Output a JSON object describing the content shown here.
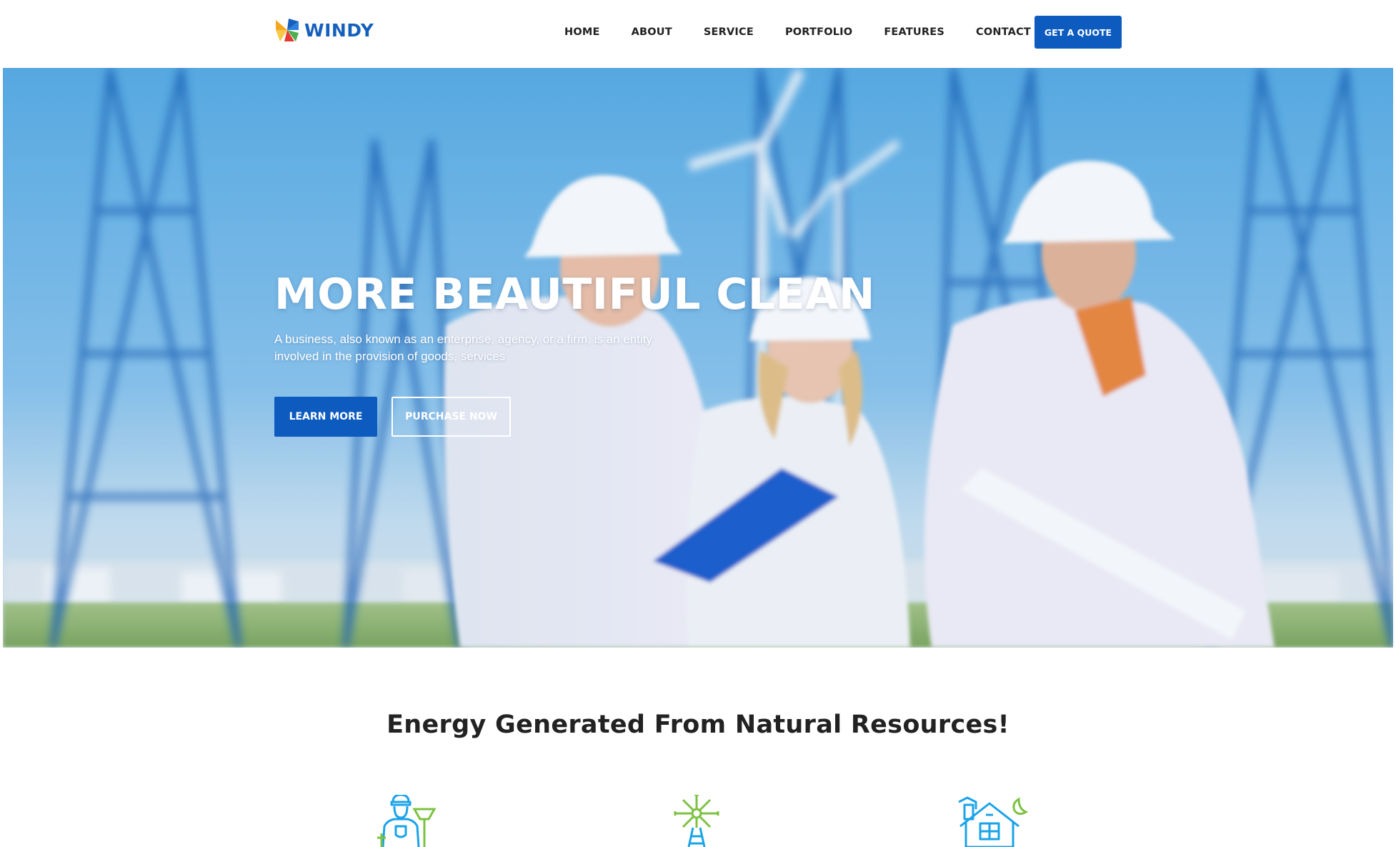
{
  "brand": {
    "name": "WINDY",
    "logo_colors": [
      "#f5a623",
      "#1560bd",
      "#4caf50",
      "#e53935"
    ]
  },
  "nav": {
    "items": [
      "HOME",
      "ABOUT",
      "SERVICE",
      "PORTFOLIO",
      "FEATURES",
      "CONTACT"
    ],
    "cta_label": "GET A QUOTE"
  },
  "hero": {
    "title": "MORE BEAUTIFUL CLEAN",
    "subtitle": "A business, also known as an enterprise, agency, or a firm, is an entity involved in the provision of goods, services",
    "primary_button": "LEARN MORE",
    "secondary_button": "PURCHASE NOW"
  },
  "section": {
    "title": "Energy Generated From Natural Resources!",
    "features": [
      {
        "icon": "engineer-icon"
      },
      {
        "icon": "wind-turbine-icon"
      },
      {
        "icon": "eco-house-icon"
      }
    ]
  },
  "colors": {
    "accent": "#0d5bbf",
    "icon_blue": "#1aa3e8",
    "icon_green": "#7cc242"
  }
}
